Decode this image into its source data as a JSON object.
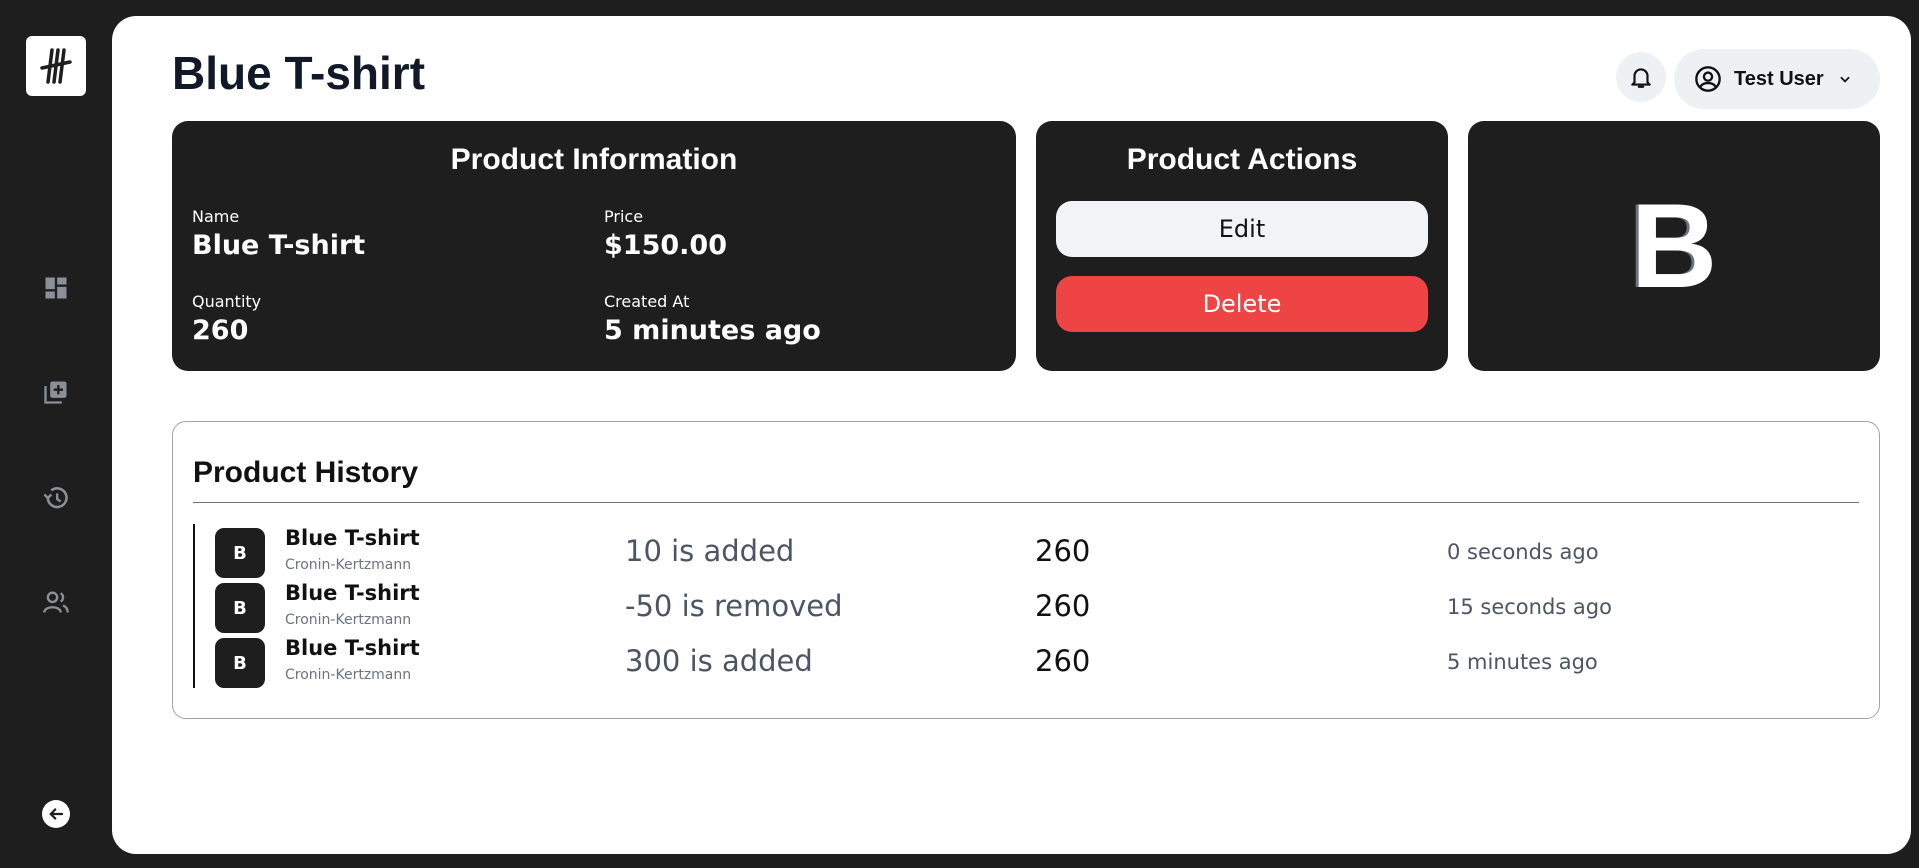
{
  "page": {
    "title": "Blue T-shirt"
  },
  "header": {
    "user_name": "Test User"
  },
  "sidebar": {
    "items": [
      {
        "icon": "dashboard-icon"
      },
      {
        "icon": "add-product-icon"
      },
      {
        "icon": "history-icon"
      },
      {
        "icon": "users-icon"
      }
    ],
    "logout_icon": "logout-icon"
  },
  "product_info": {
    "title": "Product Information",
    "name_label": "Name",
    "name_value": "Blue T-shirt",
    "price_label": "Price",
    "price_value": "$150.00",
    "quantity_label": "Quantity",
    "quantity_value": "260",
    "created_label": "Created At",
    "created_value": "5 minutes ago"
  },
  "product_actions": {
    "title": "Product Actions",
    "edit_label": "Edit",
    "delete_label": "Delete"
  },
  "avatar": {
    "letter": "B"
  },
  "history": {
    "title": "Product History",
    "rows": [
      {
        "initial": "B",
        "name": "Blue T-shirt",
        "brand": "Cronin-Kertzmann",
        "change": "10 is added",
        "quantity": "260",
        "time": "0 seconds ago"
      },
      {
        "initial": "B",
        "name": "Blue T-shirt",
        "brand": "Cronin-Kertzmann",
        "change": "-50 is removed",
        "quantity": "260",
        "time": "15 seconds ago"
      },
      {
        "initial": "B",
        "name": "Blue T-shirt",
        "brand": "Cronin-Kertzmann",
        "change": "300 is added",
        "quantity": "260",
        "time": "5 minutes ago"
      }
    ]
  },
  "colors": {
    "dark": "#1e1e1e",
    "danger": "#ef4444",
    "light": "#f1f4f7"
  }
}
